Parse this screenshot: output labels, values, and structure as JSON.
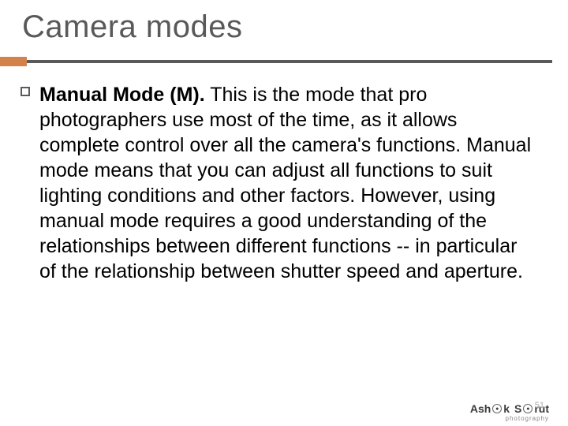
{
  "slide": {
    "title": "Camera modes",
    "bullet": {
      "bold_lead": "Manual Mode (M).",
      "body_text": " This is the mode that pro photographers use most of the time, as it allows complete control over all the camera's functions. Manual mode means that you can adjust all functions to suit lighting conditions and other factors. However, using manual mode requires a good understanding of the relationships between different functions -- in particular of the relationship between shutter speed and aperture."
    }
  },
  "footer": {
    "brand_first": "Ash",
    "brand_last": "k",
    "brand_surname_pre": "S",
    "brand_surname_post": "rut",
    "subline": "photography",
    "page_number": "51"
  }
}
